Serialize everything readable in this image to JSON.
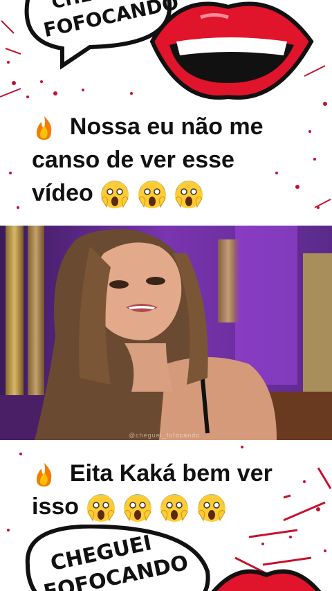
{
  "top_banner": {
    "bubble_line1": "CHEGUEI",
    "bubble_line2": "FOFOCANDO",
    "caption_line1": "Nossa eu não me",
    "caption_line2": "canso de ver esse",
    "caption_line3": "vídeo"
  },
  "bottom_banner": {
    "bubble_line1": "CHEGUEI",
    "bubble_line2": "FOFOCANDO",
    "caption_line1": "Eita Kaká bem ver",
    "caption_line2": "isso"
  },
  "video": {
    "watermark": "@cheguei_fofocando"
  },
  "icons": {
    "fire": "fire-emoji-icon",
    "scream": "face-screaming-in-fear-emoji-icon"
  },
  "colors": {
    "lips": "#e0142a",
    "splatter": "#c8102e",
    "studio_purple": "#6b2d9c",
    "caption_text": "#111111"
  }
}
